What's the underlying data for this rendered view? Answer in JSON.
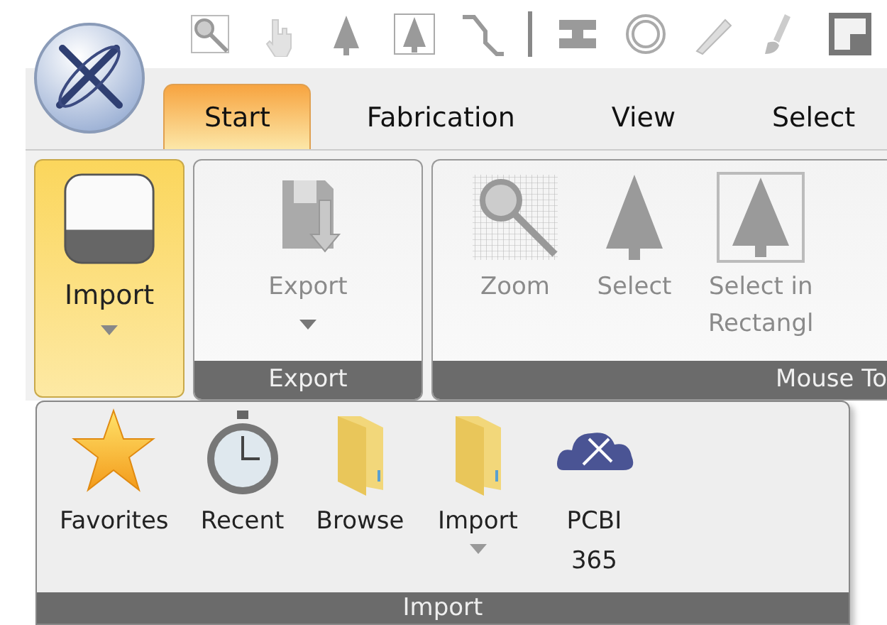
{
  "quick_access": [
    {
      "kind": "zoom-box"
    },
    {
      "kind": "hand"
    },
    {
      "kind": "arrow"
    },
    {
      "kind": "arrow-box"
    },
    {
      "kind": "route"
    },
    {
      "kind": "separator"
    },
    {
      "kind": "bar"
    },
    {
      "kind": "ring"
    },
    {
      "kind": "pencil"
    },
    {
      "kind": "brush"
    },
    {
      "kind": "square"
    }
  ],
  "tabs": [
    {
      "label": "Start",
      "selected": true
    },
    {
      "label": "Fabrication",
      "selected": false
    },
    {
      "label": "View",
      "selected": false
    },
    {
      "label": "Select",
      "selected": false
    }
  ],
  "ribbon": {
    "import_button": {
      "label": "Import",
      "expanded": true
    },
    "groups": [
      {
        "label": "Export",
        "buttons": [
          {
            "kind": "floppy",
            "label_lines": [
              "Export"
            ],
            "disabled": true,
            "has_menu": true
          }
        ]
      },
      {
        "label": "Mouse To",
        "buttons": [
          {
            "kind": "zoom",
            "label_lines": [
              "Zoom"
            ],
            "disabled": true,
            "has_menu": false
          },
          {
            "kind": "arrow",
            "label_lines": [
              "Select"
            ],
            "disabled": true,
            "has_menu": false
          },
          {
            "kind": "arrow-box",
            "label_lines": [
              "Select in",
              "Rectangl"
            ],
            "disabled": true,
            "has_menu": false
          }
        ]
      }
    ]
  },
  "import_menu": {
    "label": "Import",
    "items": [
      {
        "kind": "star",
        "label_lines": [
          "Favorites"
        ],
        "has_menu": false
      },
      {
        "kind": "stopwatch",
        "label_lines": [
          "Recent"
        ],
        "has_menu": false
      },
      {
        "kind": "folder",
        "label_lines": [
          "Browse"
        ],
        "has_menu": false
      },
      {
        "kind": "folder",
        "label_lines": [
          "Import"
        ],
        "has_menu": true
      },
      {
        "kind": "cloud",
        "label_lines": [
          "PCBI",
          "365"
        ],
        "has_menu": false
      }
    ]
  }
}
